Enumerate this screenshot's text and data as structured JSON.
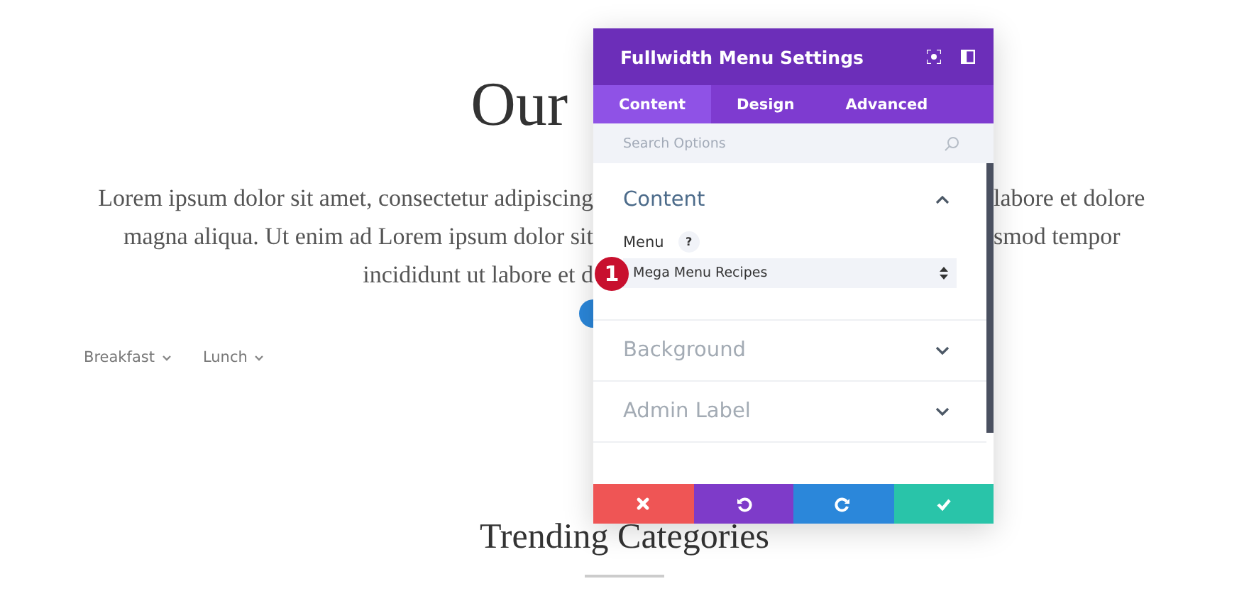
{
  "page": {
    "title": "Our",
    "intro": [
      {
        "left": "Lorem ipsum dolor sit amet, consectetur adipiscing",
        "right": "labore et dolore"
      },
      {
        "left": "magna aliqua. Ut enim ad Lorem ipsum dolor sit",
        "right": "smod tempor"
      },
      {
        "left": "incididunt ut labore et d"
      }
    ],
    "menu": [
      {
        "label": "Breakfast"
      },
      {
        "label": "Lunch"
      }
    ],
    "section_title": "Trending Categories"
  },
  "modal": {
    "title": "Fullwidth Menu Settings",
    "tabs": [
      {
        "label": "Content",
        "selected": true
      },
      {
        "label": "Design",
        "selected": false
      },
      {
        "label": "Advanced",
        "selected": false
      }
    ],
    "search": {
      "placeholder": "Search Options"
    },
    "sections": [
      {
        "title": "Content",
        "expanded": true,
        "field": {
          "label": "Menu",
          "help": "?",
          "value": "Mega Menu Recipes"
        }
      },
      {
        "title": "Background",
        "expanded": false
      },
      {
        "title": "Admin Label",
        "expanded": false
      }
    ],
    "footer_buttons": [
      {
        "kind": "cancel"
      },
      {
        "kind": "undo"
      },
      {
        "kind": "redo"
      },
      {
        "kind": "save"
      }
    ]
  },
  "annotation": {
    "badge": "1"
  }
}
